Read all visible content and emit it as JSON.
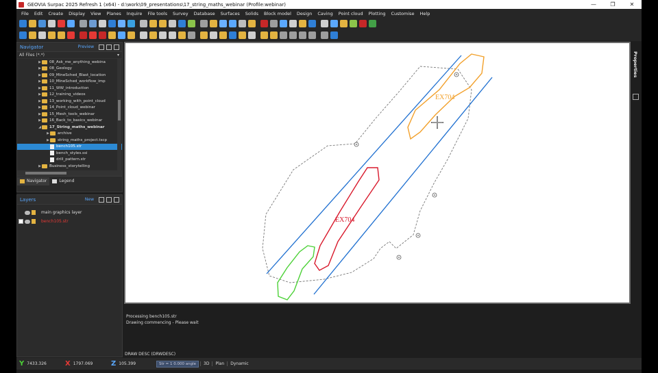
{
  "window": {
    "title": "GEOVIA Surpac 2025 Refresh 1 (x64) - d:\\work\\09_presentations\\17_string_maths_webinar (Profile:webinar)",
    "minimize": "—",
    "restore": "❐",
    "close": "✕"
  },
  "menu": [
    "File",
    "Edit",
    "Create",
    "Display",
    "View",
    "Planes",
    "Inquire",
    "File tools",
    "Survey",
    "Database",
    "Surfaces",
    "Solids",
    "Block model",
    "Design",
    "Caving",
    "Point cloud",
    "Plotting",
    "Customise",
    "Help"
  ],
  "toolbar_colors": {
    "row1": [
      "#2f7fd6",
      "#e3b341",
      "#4a90d9",
      "#cfcfcf",
      "#e53935",
      "#5aa8ff",
      "#9aa0a6",
      "#6c9bd2",
      "#cfcfcf",
      "#2f7fd6",
      "#6ab0ff",
      "#3aa0e0",
      "#bdbdbd",
      "#e3b341",
      "#e3b341",
      "#c8c8c8",
      "#2f7fd6",
      "#8bc34a",
      "#9e9e9e",
      "#e3b341",
      "#6ab0ff",
      "#5aa8ff",
      "#bdbdbd",
      "#e3b341",
      "#c62828",
      "#9e9e9e",
      "#5aa8ff",
      "#cfcfcf",
      "#e3b341",
      "#2f7fd6",
      "#cfcfcf",
      "#5aa8ff",
      "#e3b341",
      "#8bc34a",
      "#c62828",
      "#43a047"
    ],
    "row2": [
      "#2f7fd6",
      "#e3b341",
      "#cfcfcf",
      "#e3b341",
      "#e3b341",
      "#e53935",
      "#c62828",
      "#e53935",
      "#c62828",
      "#e3b341",
      "#5aa8ff",
      "#e3b341",
      "#cfcfcf",
      "#e3b341",
      "#cfcfcf",
      "#cfcfcf",
      "#e3b341",
      "#9e9e9e",
      "#e3b341",
      "#cfcfcf",
      "#e3b341",
      "#2f7fd6",
      "#e3b341",
      "#cfcfcf",
      "#e3b341",
      "#e3b341",
      "#9e9e9e",
      "#9e9e9e",
      "#9e9e9e",
      "#9e9e9e",
      "#9e9e9e",
      "#2f7fd6"
    ]
  },
  "navigator": {
    "title": "Navigator",
    "preview": "Preview",
    "filter": "All Files (*.*)",
    "items": [
      {
        "label": "08_Ask_me_anything_webina",
        "type": "folder",
        "indent": 1
      },
      {
        "label": "08_Geology",
        "type": "folder",
        "indent": 1
      },
      {
        "label": "09_MineSched_Blast_location",
        "type": "folder",
        "indent": 1
      },
      {
        "label": "10_MineSched_workflow_imp",
        "type": "folder",
        "indent": 1
      },
      {
        "label": "11_WW_introduction",
        "type": "folder",
        "indent": 1
      },
      {
        "label": "12_training_videos",
        "type": "folder",
        "indent": 1
      },
      {
        "label": "13_working_with_point_cloud",
        "type": "folder",
        "indent": 1
      },
      {
        "label": "14_Point_cloud_webinar",
        "type": "folder",
        "indent": 1
      },
      {
        "label": "15_Mesh_tools_webinar",
        "type": "folder",
        "indent": 1
      },
      {
        "label": "16_Back_to_basics_webinar",
        "type": "folder",
        "indent": 1
      },
      {
        "label": "17_String_maths_webinar",
        "type": "folder-open",
        "indent": 1
      },
      {
        "label": "archive",
        "type": "folder",
        "indent": 2
      },
      {
        "label": "string_maths_project.tscp",
        "type": "folder",
        "indent": 2
      },
      {
        "label": "bench105.str",
        "type": "file",
        "indent": 2
      },
      {
        "label": "bench_styles.ssi",
        "type": "file",
        "indent": 2
      },
      {
        "label": "drill_pattern.str",
        "type": "file",
        "indent": 2
      },
      {
        "label": "Business_storytelling",
        "type": "folder",
        "indent": 1
      }
    ],
    "tabs": [
      "Navigator",
      "Legend"
    ]
  },
  "layers": {
    "title": "Layers",
    "new": "New",
    "items": [
      {
        "label": "main graphics layer",
        "color": "#dddddd",
        "checked": false
      },
      {
        "label": "bench105.str",
        "color": "#e53935",
        "checked": true
      }
    ]
  },
  "canvas": {
    "label_top": "EX704",
    "label_mid": "EX704"
  },
  "properties": {
    "label": "Properties"
  },
  "messages": [
    "Processing bench105.str",
    "Drawing commencing - Please wait"
  ],
  "command": "DRAW DESC (DRWDESC)",
  "status": {
    "y_label": "Y",
    "y_value": "7433.326",
    "x_label": "X",
    "x_value": "1797.069",
    "z_label": "Z",
    "z_value": "105.399",
    "mode_value": "Str = 1  0.000 angle",
    "btn_3d": "3D",
    "btn_plan": "Plan",
    "btn_dynamic": "Dynamic"
  }
}
